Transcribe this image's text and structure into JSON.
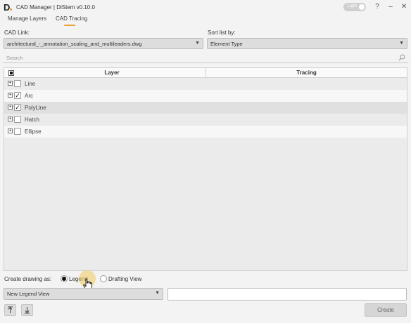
{
  "app": {
    "title": "CAD Manager | DiStem v0.10.0",
    "theme_toggle_label": "Light"
  },
  "tabs": [
    {
      "label": "Manage Layers",
      "active": false
    },
    {
      "label": "CAD Tracing",
      "active": true
    }
  ],
  "cad_link": {
    "label": "CAD Link:",
    "value": "architectural_-_annotation_scaling_and_multileaders.dwg"
  },
  "sort": {
    "label": "Sort list by:",
    "value": "Element Type"
  },
  "search": {
    "placeholder": "Search"
  },
  "grid": {
    "columns": [
      "Layer",
      "Tracing"
    ],
    "rows": [
      {
        "label": "Line",
        "checked": false
      },
      {
        "label": "Arc",
        "checked": true
      },
      {
        "label": "PolyLine",
        "checked": true
      },
      {
        "label": "Hatch",
        "checked": false
      },
      {
        "label": "Ellipse",
        "checked": false
      }
    ]
  },
  "create_as": {
    "label": "Create drawing as:",
    "options": [
      "Legend",
      "Drafting View"
    ],
    "selected": "Legend"
  },
  "view_select": {
    "value": "New Legend View"
  },
  "buttons": {
    "create": "Create"
  },
  "colors": {
    "accent": "#e8a23a",
    "background": "#f3f3f3"
  }
}
